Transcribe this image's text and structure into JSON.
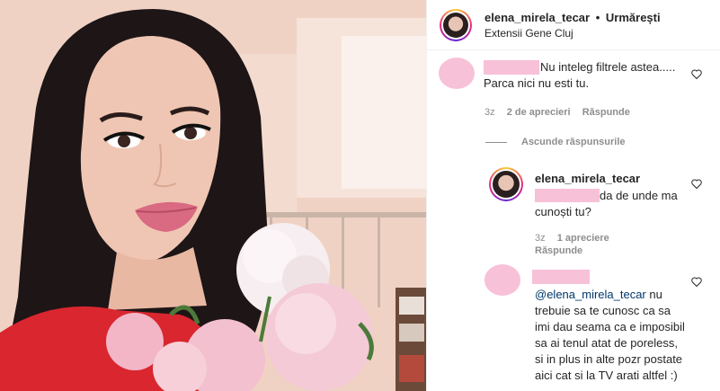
{
  "post": {
    "author": "elena_mirela_tecar",
    "separator": "•",
    "follow_label": "Urmărești",
    "location": "Extensii Gene Cluj"
  },
  "comments": [
    {
      "text": "Nu inteleg filtrele astea..... Parca nici nu esti tu.",
      "time": "3z",
      "likes": "2 de aprecieri",
      "reply_label": "Răspunde",
      "hide_replies_label": "Ascunde răspunsurile"
    },
    {
      "author": "elena_mirela_tecar",
      "text": "da de unde ma cunoști tu?",
      "time": "3z",
      "likes": "1 apreciere",
      "reply_label": "Răspunde"
    },
    {
      "mention": "@elena_mirela_tecar",
      "text": " nu trebuie sa te cunosc ca sa imi dau seama ca e imposibil sa ai tenul atat de poreless, si in plus in alte pozr postate aici cat si la TV arati altfel :)"
    }
  ],
  "colors": {
    "redaction_pink": "#f7c1d8",
    "muted_text": "#8e8e8e",
    "mention_blue": "#00376b"
  },
  "icons": [
    "heart-icon",
    "avatar"
  ]
}
